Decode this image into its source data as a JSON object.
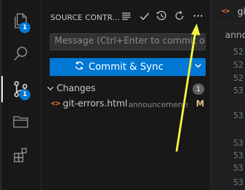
{
  "activity_bar": {
    "explorer_badge": "1",
    "scm_badge": "1",
    "colors": {
      "badge": "#0078d4",
      "icon": "#858585",
      "active_icon": "#d7d7d7"
    }
  },
  "scm": {
    "title": "SOURCE CONTR...",
    "commit_placeholder": "Message (Ctrl+Enter to commit o...",
    "commit_button_label": "Commit & Sync",
    "changes_label": "Changes",
    "changes_count": "1",
    "file": {
      "icon": "<>",
      "name": "git-errors.html",
      "directory": "announcements",
      "status": "M"
    },
    "toolbar_icons": [
      "view-as-tree-icon",
      "commit-check-icon",
      "history-icon",
      "refresh-icon",
      "more-actions-icon"
    ]
  },
  "editor": {
    "tab_icon": "<>",
    "tab_label": "gi",
    "breadcrumb": "anno",
    "line_numbers": [
      "52",
      "52",
      "52",
      "53",
      "53",
      "53",
      "53",
      "53",
      "53"
    ]
  },
  "annotation": {
    "arrow_color": "#f5f542"
  }
}
